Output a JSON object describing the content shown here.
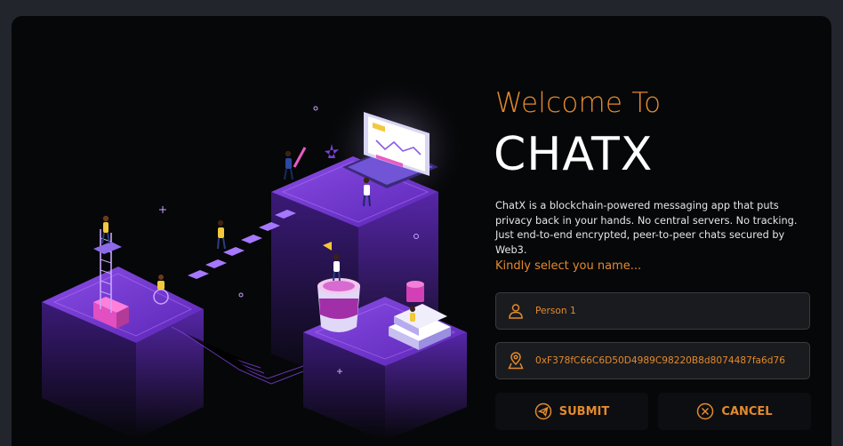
{
  "hero": {
    "welcome": "Welcome To",
    "brand": "CHATX",
    "description": "ChatX is a blockchain-powered messaging app that puts privacy back in your hands. No central servers. No tracking. Just end-to-end encrypted, peer-to-peer chats secured by Web3.",
    "prompt": "Kindly select you name..."
  },
  "form": {
    "name_value": "Person 1",
    "address_value": "0xF378fC66C6D50D4989C98220B8d8074487fa6d76",
    "submit_label": "SUBMIT",
    "cancel_label": "CANCEL"
  },
  "icons": {
    "name_field": "user-icon",
    "address_field": "location-pin-icon",
    "submit": "send-icon",
    "cancel": "close-circle-icon"
  },
  "colors": {
    "accent": "#e28a2e",
    "background": "#060709",
    "illustration_purple": "#7b3fd4"
  }
}
